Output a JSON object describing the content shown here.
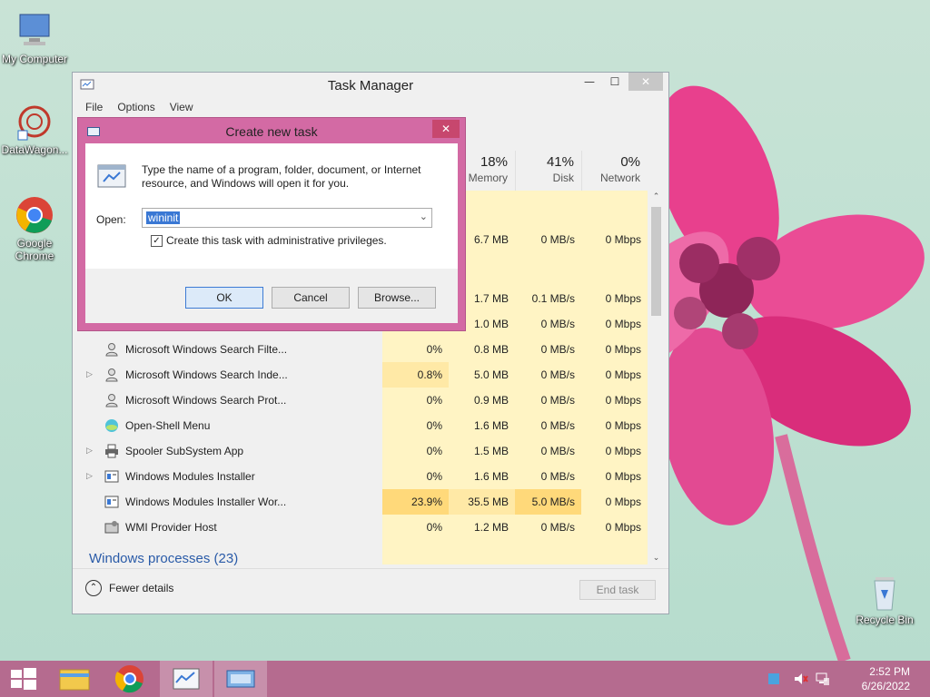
{
  "desktop": {
    "icons": [
      {
        "label": "My Computer",
        "icon": "computer-icon"
      },
      {
        "label": "DataWagon...",
        "icon": "datawagon-icon"
      },
      {
        "label": "Google Chrome",
        "icon": "chrome-icon"
      },
      {
        "label": "Recycle Bin",
        "icon": "recycle-bin-icon"
      }
    ]
  },
  "task_manager": {
    "title": "Task Manager",
    "menu": [
      "File",
      "Options",
      "View"
    ],
    "columns": [
      {
        "pct": "18%",
        "name": "Memory"
      },
      {
        "pct": "41%",
        "name": "Disk"
      },
      {
        "pct": "0%",
        "name": "Network"
      }
    ],
    "rows_partial": [
      {
        "cpu": "",
        "mem": "6.7 MB",
        "disk": "0 MB/s",
        "net": "0 Mbps"
      },
      {
        "cpu": "",
        "mem": "1.7 MB",
        "disk": "0.1 MB/s",
        "net": "0 Mbps"
      },
      {
        "cpu": "",
        "mem": "1.0 MB",
        "disk": "0 MB/s",
        "net": "0 Mbps"
      }
    ],
    "rows": [
      {
        "name": "Microsoft Windows Search Filte...",
        "expandable": false,
        "cpu": "0%",
        "mem": "0.8 MB",
        "disk": "0 MB/s",
        "net": "0 Mbps"
      },
      {
        "name": "Microsoft Windows Search Inde...",
        "expandable": true,
        "cpu": "0.8%",
        "mem": "5.0 MB",
        "disk": "0 MB/s",
        "net": "0 Mbps"
      },
      {
        "name": "Microsoft Windows Search Prot...",
        "expandable": false,
        "cpu": "0%",
        "mem": "0.9 MB",
        "disk": "0 MB/s",
        "net": "0 Mbps"
      },
      {
        "name": "Open-Shell Menu",
        "expandable": false,
        "cpu": "0%",
        "mem": "1.6 MB",
        "disk": "0 MB/s",
        "net": "0 Mbps"
      },
      {
        "name": "Spooler SubSystem App",
        "expandable": true,
        "cpu": "0%",
        "mem": "1.5 MB",
        "disk": "0 MB/s",
        "net": "0 Mbps"
      },
      {
        "name": "Windows Modules Installer",
        "expandable": true,
        "cpu": "0%",
        "mem": "1.6 MB",
        "disk": "0 MB/s",
        "net": "0 Mbps"
      },
      {
        "name": "Windows Modules Installer Wor...",
        "expandable": false,
        "cpu": "23.9%",
        "mem": "35.5 MB",
        "disk": "5.0 MB/s",
        "net": "0 Mbps"
      },
      {
        "name": "WMI Provider Host",
        "expandable": false,
        "cpu": "0%",
        "mem": "1.2 MB",
        "disk": "0 MB/s",
        "net": "0 Mbps"
      }
    ],
    "section_label": "Windows processes (23)",
    "fewer_details": "Fewer details",
    "end_task": "End task"
  },
  "dialog": {
    "title": "Create new task",
    "description": "Type the name of a program, folder, document, or Internet resource, and Windows will open it for you.",
    "open_label": "Open:",
    "open_value": "wininit",
    "admin_label": "Create this task with administrative privileges.",
    "admin_checked": true,
    "ok": "OK",
    "cancel": "Cancel",
    "browse": "Browse..."
  },
  "taskbar": {
    "time": "2:52 PM",
    "date": "6/26/2022",
    "accent": "#b56b8f"
  }
}
